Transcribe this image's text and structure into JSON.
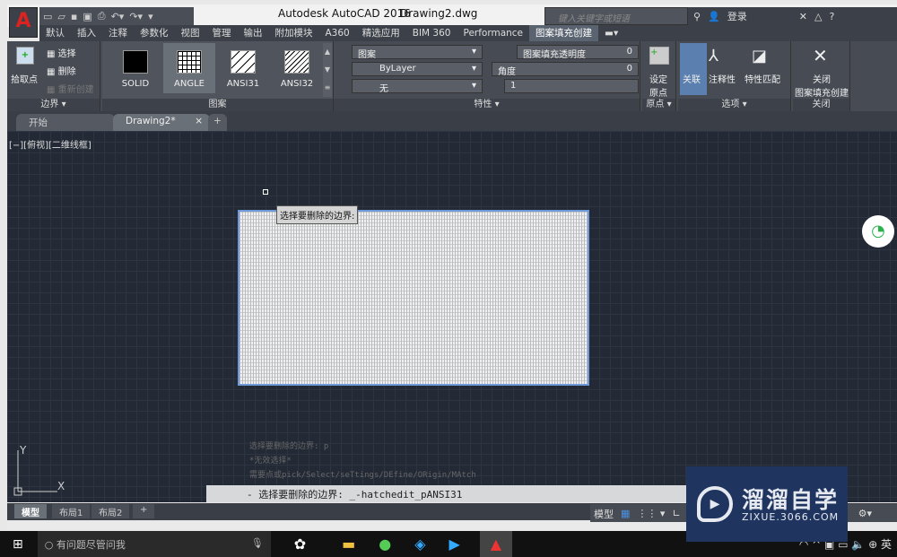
{
  "window": {
    "app_title": "Autodesk AutoCAD 2016",
    "doc_title": "Drawing2.dwg"
  },
  "search": {
    "placeholder": "键入关键字或短语"
  },
  "user": {
    "login": "登录"
  },
  "ribbon_tabs": [
    "默认",
    "插入",
    "注释",
    "参数化",
    "视图",
    "管理",
    "输出",
    "附加模块",
    "A360",
    "精选应用",
    "BIM 360",
    "Performance",
    "图案填充创建"
  ],
  "active_tab": "图案填充创建",
  "boundary": {
    "pick": "拾取点",
    "select": "选择",
    "remove": "删除",
    "recreate": "重新创建",
    "title": "边界 ▾"
  },
  "pattern": {
    "items": [
      "SOLID",
      "ANGLE",
      "ANSI31",
      "ANSI32"
    ],
    "selected": "ANGLE",
    "title": "图案"
  },
  "properties": {
    "type": "图案",
    "color": "ByLayer",
    "bgcolor": "无",
    "transparency_label": "图案填充透明度",
    "transparency": "0",
    "angle_label": "角度",
    "angle": "0",
    "scale": "1",
    "title": "特性 ▾"
  },
  "origin": {
    "set": "设定",
    "set2": "原点",
    "title": "原点 ▾"
  },
  "options": {
    "associative": "关联",
    "annotative": "注释性",
    "match": "特性匹配",
    "title": "选项 ▾"
  },
  "close": {
    "label1": "关闭",
    "label2": "图案填充创建",
    "title": "关闭"
  },
  "file_tabs": [
    "开始",
    "Drawing2*"
  ],
  "view_label": "[−][俯视][二维线框]",
  "tooltip": "选择要删除的边界:",
  "history": [
    "选择要删除的边界: p",
    "*无效选择*",
    "需要点或pick/Select/seTtings/DEfine/ORigin/MAtch"
  ],
  "command_line": "- 选择要删除的边界: _-hatchedit_pANSI31",
  "ucs": {
    "x": "X",
    "y": "Y"
  },
  "layout_tabs": [
    "模型",
    "布局1",
    "布局2"
  ],
  "status": {
    "model": "模型"
  },
  "taskbar": {
    "search_placeholder": "有问题尽管问我",
    "ime": "英"
  },
  "watermark": {
    "title": "溜溜自学",
    "url": "ZIXUE.3066.COM"
  },
  "colors": {
    "accent": "#6f9ad9",
    "canvas": "#232a35",
    "ribbon": "#474c54"
  }
}
